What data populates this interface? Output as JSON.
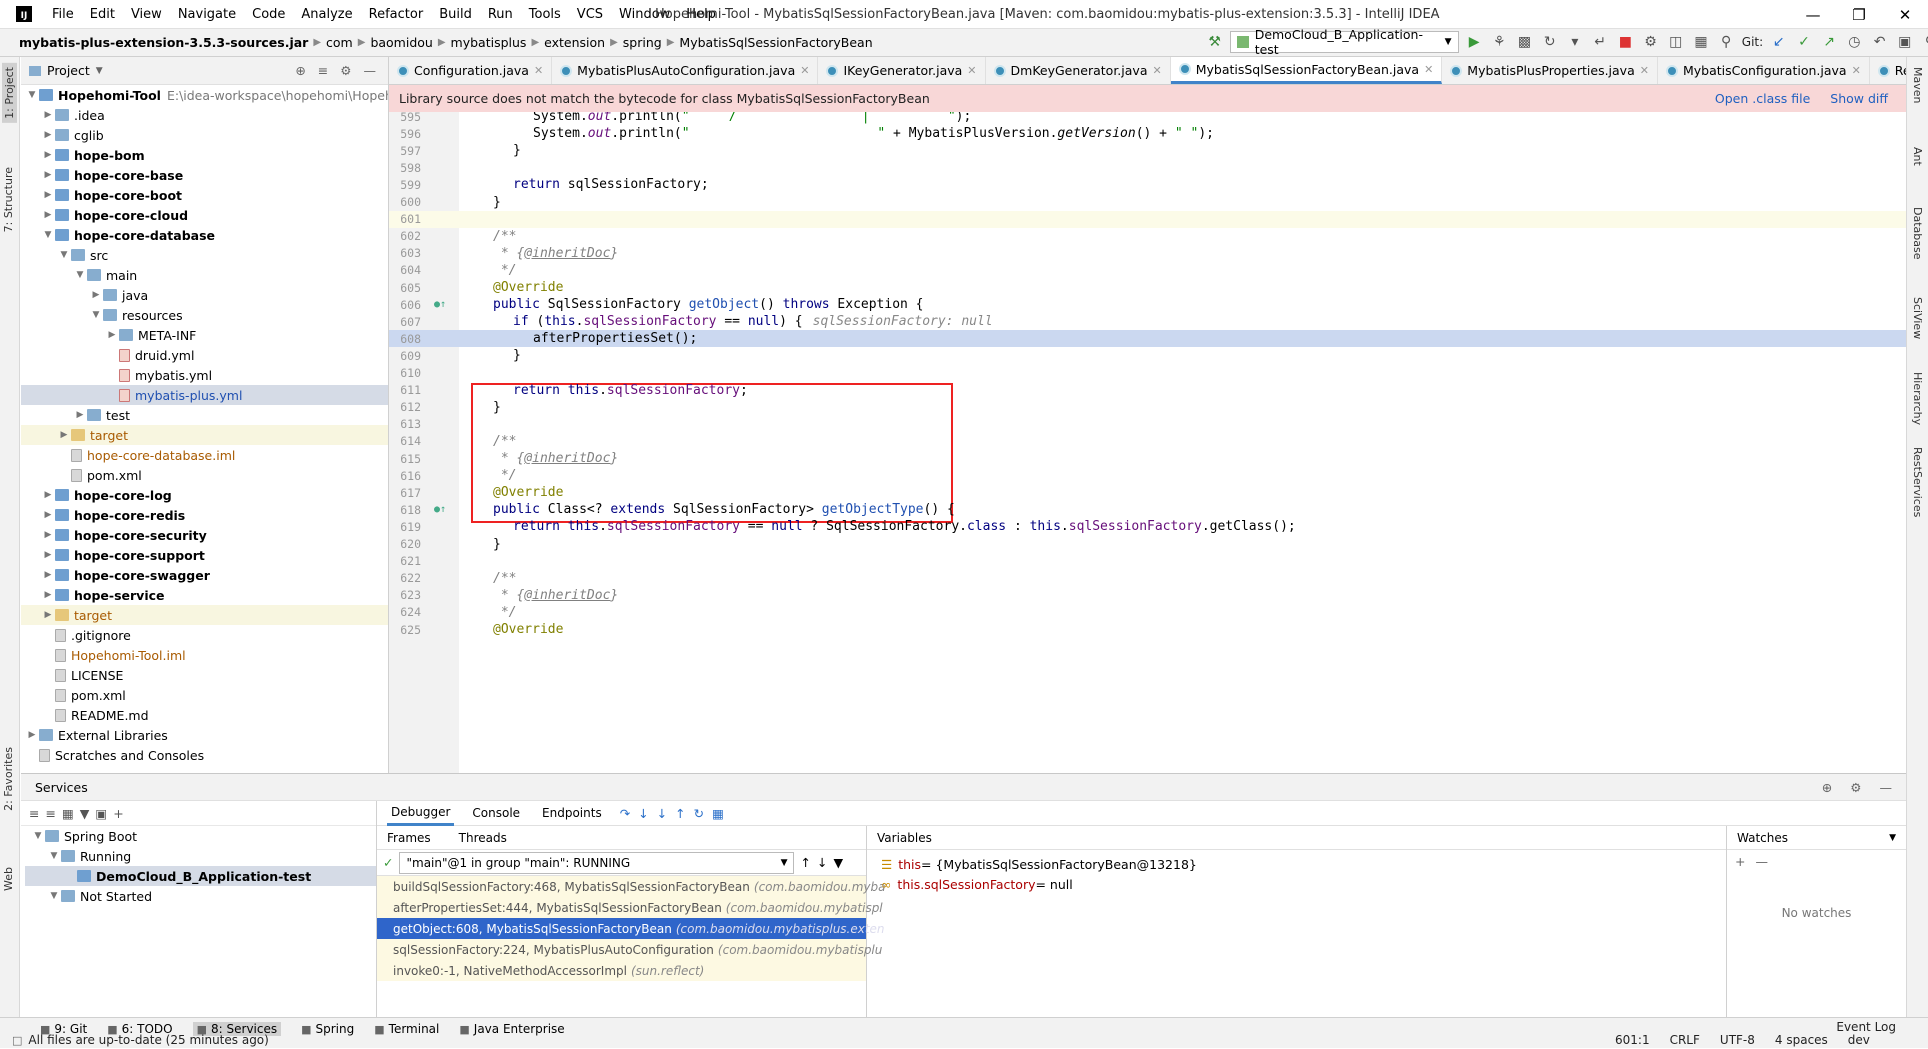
{
  "menu": [
    "File",
    "Edit",
    "View",
    "Navigate",
    "Code",
    "Analyze",
    "Refactor",
    "Build",
    "Run",
    "Tools",
    "VCS",
    "Window",
    "Help"
  ],
  "window_title": "Hopehomi-Tool - MybatisSqlSessionFactoryBean.java [Maven: com.baomidou:mybatis-plus-extension:3.5.3] - IntelliJ IDEA",
  "breadcrumbs": [
    "mybatis-plus-extension-3.5.3-sources.jar",
    "com",
    "baomidou",
    "mybatisplus",
    "extension",
    "spring",
    "MybatisSqlSessionFactoryBean"
  ],
  "run_config": "DemoCloud_B_Application-test",
  "git_label": "Git:",
  "project_panel": {
    "title": "Project",
    "root_name": "Hopehomi-Tool",
    "root_path": "E:\\idea-workspace\\hopehomi\\Hopehom",
    "items": [
      {
        "label": ".idea",
        "indent": 1,
        "icon": "folder"
      },
      {
        "label": "cglib",
        "indent": 1,
        "icon": "folder"
      },
      {
        "label": "hope-bom",
        "indent": 1,
        "icon": "module",
        "bold": true
      },
      {
        "label": "hope-core-base",
        "indent": 1,
        "icon": "module",
        "bold": true
      },
      {
        "label": "hope-core-boot",
        "indent": 1,
        "icon": "module",
        "bold": true
      },
      {
        "label": "hope-core-cloud",
        "indent": 1,
        "icon": "module",
        "bold": true
      },
      {
        "label": "hope-core-database",
        "indent": 1,
        "icon": "module",
        "bold": true,
        "open": true
      },
      {
        "label": "src",
        "indent": 2,
        "icon": "folder",
        "open": true
      },
      {
        "label": "main",
        "indent": 3,
        "icon": "folder",
        "open": true
      },
      {
        "label": "java",
        "indent": 4,
        "icon": "folder"
      },
      {
        "label": "resources",
        "indent": 4,
        "icon": "folder",
        "open": true
      },
      {
        "label": "META-INF",
        "indent": 5,
        "icon": "folder"
      },
      {
        "label": "druid.yml",
        "indent": 5,
        "icon": "yml",
        "noarrow": true
      },
      {
        "label": "mybatis.yml",
        "indent": 5,
        "icon": "yml",
        "noarrow": true
      },
      {
        "label": "mybatis-plus.yml",
        "indent": 5,
        "icon": "yml",
        "noarrow": true,
        "selected": true,
        "blue": true
      },
      {
        "label": "test",
        "indent": 3,
        "icon": "folder"
      },
      {
        "label": "target",
        "indent": 2,
        "icon": "folder-yellow",
        "orange": true,
        "hl": true
      },
      {
        "label": "hope-core-database.iml",
        "indent": 2,
        "icon": "file",
        "noarrow": true,
        "orange": true
      },
      {
        "label": "pom.xml",
        "indent": 2,
        "icon": "maven",
        "noarrow": true
      },
      {
        "label": "hope-core-log",
        "indent": 1,
        "icon": "module",
        "bold": true
      },
      {
        "label": "hope-core-redis",
        "indent": 1,
        "icon": "module",
        "bold": true
      },
      {
        "label": "hope-core-security",
        "indent": 1,
        "icon": "module",
        "bold": true
      },
      {
        "label": "hope-core-support",
        "indent": 1,
        "icon": "module",
        "bold": true
      },
      {
        "label": "hope-core-swagger",
        "indent": 1,
        "icon": "module",
        "bold": true
      },
      {
        "label": "hope-service",
        "indent": 1,
        "icon": "module",
        "bold": true
      },
      {
        "label": "target",
        "indent": 1,
        "icon": "folder-yellow",
        "orange": true,
        "hl": true
      },
      {
        "label": ".gitignore",
        "indent": 1,
        "icon": "file",
        "noarrow": true
      },
      {
        "label": "Hopehomi-Tool.iml",
        "indent": 1,
        "icon": "file",
        "noarrow": true,
        "orange": true
      },
      {
        "label": "LICENSE",
        "indent": 1,
        "icon": "file",
        "noarrow": true
      },
      {
        "label": "pom.xml",
        "indent": 1,
        "icon": "maven",
        "noarrow": true
      },
      {
        "label": "README.md",
        "indent": 1,
        "icon": "file",
        "noarrow": true
      },
      {
        "label": "External Libraries",
        "indent": 0,
        "icon": "lib"
      },
      {
        "label": "Scratches and Consoles",
        "indent": 0,
        "icon": "scratch",
        "noarrow": true
      }
    ]
  },
  "editor_tabs": [
    {
      "label": "Configuration.java"
    },
    {
      "label": "MybatisPlusAutoConfiguration.java"
    },
    {
      "label": "IKeyGenerator.java"
    },
    {
      "label": "DmKeyGenerator.java"
    },
    {
      "label": "MybatisSqlSessionFactoryBean.java",
      "active": true
    },
    {
      "label": "MybatisPlusProperties.java"
    },
    {
      "label": "MybatisConfiguration.java"
    },
    {
      "label": "ResourceF"
    }
  ],
  "banner": {
    "message": "Library source does not match the bytecode for class MybatisSqlSessionFactoryBean",
    "open_class": "Open .class file",
    "show_diff": "Show diff"
  },
  "code_lines": [
    {
      "n": "595",
      "html": "<span style=\"padding-left:40px\"></span>System.<span class=\"fl it\">out</span>.println(<span class=\"st\">\"     /                |          \"</span>);"
    },
    {
      "n": "596",
      "html": "<span style=\"padding-left:40px\"></span>System.<span class=\"fl it\">out</span>.println(<span class=\"st\">\"                        \"</span> + MybatisPlusVersion.<span class=\"it\">getVersion</span>() + <span class=\"st\">\" \"</span>);"
    },
    {
      "n": "597",
      "html": "<span style=\"padding-left:20px\"></span>}"
    },
    {
      "n": "598",
      "html": ""
    },
    {
      "n": "599",
      "html": "<span style=\"padding-left:20px\"></span><span class=\"kw\">return</span> sqlSessionFactory;"
    },
    {
      "n": "600",
      "html": "}"
    },
    {
      "n": "601",
      "html": "",
      "cur": true
    },
    {
      "n": "602",
      "html": "<span class=\"cm\">/**</span>"
    },
    {
      "n": "603",
      "html": "<span class=\"cm\"> * {</span><span class=\"cmtag\">@inheritDoc</span><span class=\"cm\">}</span>"
    },
    {
      "n": "604",
      "html": "<span class=\"cm\"> */</span>"
    },
    {
      "n": "605",
      "html": "<span class=\"an\">@Override</span>"
    },
    {
      "n": "606",
      "html": "<span class=\"kw\">public</span> SqlSessionFactory <span class=\"blue\">getObject</span>() <span class=\"kw\">throws</span> Exception {",
      "mark": "o"
    },
    {
      "n": "607",
      "html": "<span style=\"padding-left:20px\"></span><span class=\"kw\">if</span> (<span class=\"kw\">this</span>.<span class=\"fl\">sqlSessionFactory</span> == <span class=\"kw\">null</span>) {",
      "hint": "sqlSessionFactory: null"
    },
    {
      "n": "608",
      "html": "<span style=\"padding-left:40px\"></span>afterPropertiesSet();",
      "sel": true
    },
    {
      "n": "609",
      "html": "<span style=\"padding-left:20px\"></span>}"
    },
    {
      "n": "610",
      "html": ""
    },
    {
      "n": "611",
      "html": "<span style=\"padding-left:20px\"></span><span class=\"kw\">return this</span>.<span class=\"fl\">sqlSessionFactory</span>;"
    },
    {
      "n": "612",
      "html": "}"
    },
    {
      "n": "613",
      "html": ""
    },
    {
      "n": "614",
      "html": "<span class=\"cm\">/**</span>"
    },
    {
      "n": "615",
      "html": "<span class=\"cm\"> * {</span><span class=\"cmtag\">@inheritDoc</span><span class=\"cm\">}</span>"
    },
    {
      "n": "616",
      "html": "<span class=\"cm\"> */</span>"
    },
    {
      "n": "617",
      "html": "<span class=\"an\">@Override</span>"
    },
    {
      "n": "618",
      "html": "<span class=\"kw\">public</span> Class&lt;? <span class=\"kw\">extends</span> SqlSessionFactory&gt; <span class=\"blue\">getObjectType</span>() {",
      "mark": "o"
    },
    {
      "n": "619",
      "html": "<span style=\"padding-left:20px\"></span><span class=\"kw\">return this</span>.<span class=\"fl\">sqlSessionFactory</span> == <span class=\"kw\">null</span> ? SqlSessionFactory.<span class=\"kw\">class</span> : <span class=\"kw\">this</span>.<span class=\"fl\">sqlSessionFactory</span>.getClass();"
    },
    {
      "n": "620",
      "html": "}"
    },
    {
      "n": "621",
      "html": ""
    },
    {
      "n": "622",
      "html": "<span class=\"cm\">/**</span>"
    },
    {
      "n": "623",
      "html": "<span class=\"cm\"> * {</span><span class=\"cmtag\">@inheritDoc</span><span class=\"cm\">}</span>"
    },
    {
      "n": "624",
      "html": "<span class=\"cm\"> */</span>"
    },
    {
      "n": "625",
      "html": "<span class=\"an\">@Override</span>"
    }
  ],
  "services": {
    "title": "Services",
    "tree": [
      {
        "label": "Spring Boot",
        "indent": 0
      },
      {
        "label": "Running",
        "indent": 1
      },
      {
        "label": "DemoCloud_B_Application-test",
        "indent": 2,
        "selected": true,
        "bold": true
      },
      {
        "label": "Not Started",
        "indent": 1
      }
    ],
    "debug_tabs": [
      "Debugger",
      "Console",
      "Endpoints"
    ],
    "frames_tab": "Frames",
    "threads_tab": "Threads",
    "thread": "\"main\"@1 in group \"main\": RUNNING",
    "frames": [
      {
        "method": "buildSqlSessionFactory:468, MybatisSqlSessionFactoryBean",
        "pkg": "(com.baomidou.myba"
      },
      {
        "method": "afterPropertiesSet:444, MybatisSqlSessionFactoryBean",
        "pkg": "(com.baomidou.mybatispl"
      },
      {
        "method": "getObject:608, MybatisSqlSessionFactoryBean",
        "pkg": "(com.baomidou.mybatisplus.exten",
        "selected": true
      },
      {
        "method": "sqlSessionFactory:224, MybatisPlusAutoConfiguration",
        "pkg": "(com.baomidou.mybatisplu"
      },
      {
        "method": "invoke0:-1, NativeMethodAccessorImpl",
        "pkg": "(sun.reflect)"
      }
    ],
    "variables_title": "Variables",
    "vars": [
      {
        "name": "this",
        "value": " = {MybatisSqlSessionFactoryBean@13218}"
      },
      {
        "name": "this.sqlSessionFactory",
        "value": " = null"
      }
    ],
    "watches_title": "Watches",
    "no_watches": "No watches"
  },
  "left_tabs": [
    "1: Project",
    "7: Structure",
    "2: Favorites",
    "Web"
  ],
  "right_tabs": [
    "Maven",
    "Ant",
    "Database",
    "SciView",
    "Hierarchy",
    "RestServices"
  ],
  "bottom_tabs": [
    "9: Git",
    "6: TODO",
    "8: Services",
    "Spring",
    "Terminal",
    "Java Enterprise"
  ],
  "event_log": "Event Log",
  "status": {
    "message": "All files are up-to-date (25 minutes ago)",
    "position": "601:1",
    "line_sep": "CRLF",
    "encoding": "UTF-8",
    "indent": "4 spaces",
    "branch": "dev"
  }
}
